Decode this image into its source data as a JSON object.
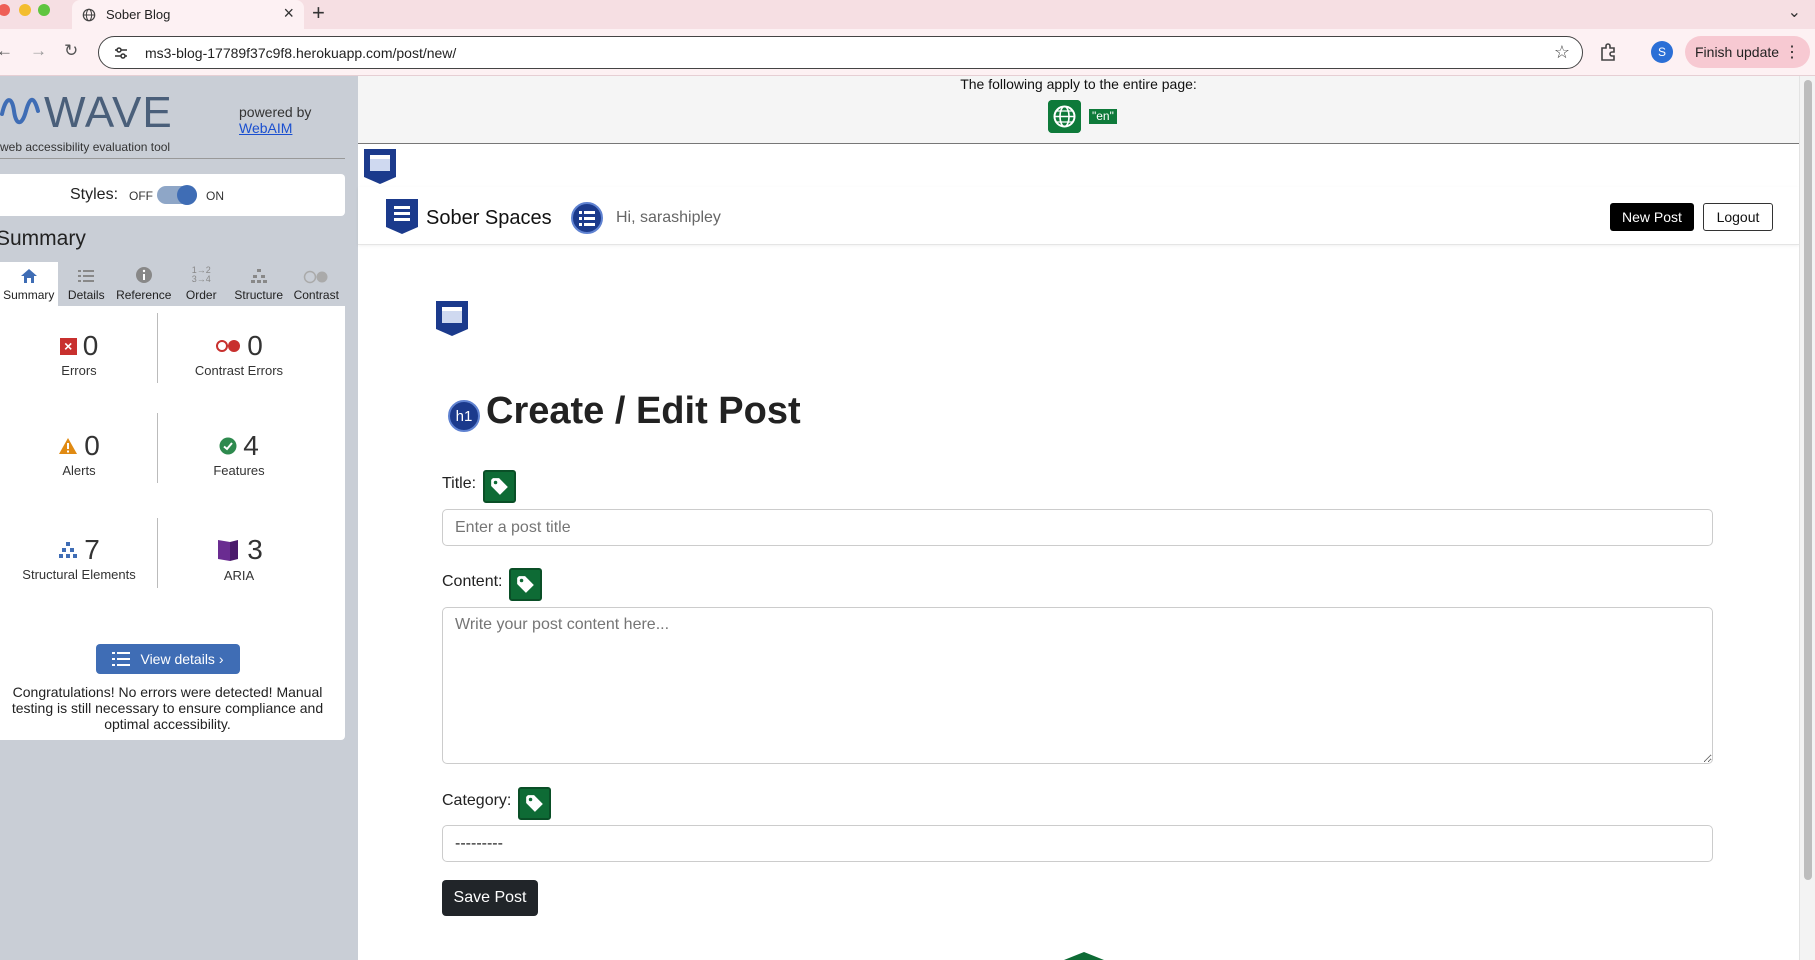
{
  "browser": {
    "tab_title": "Sober Blog",
    "tab_close": "×",
    "new_tab": "+",
    "url": "ms3-blog-17789f37c9f8.herokuapp.com/post/new/",
    "profile_initial": "S",
    "finish_update": "Finish update"
  },
  "wave": {
    "name": "WAVE",
    "subtitle": "web accessibility evaluation tool",
    "powered_by": "powered by",
    "webaim": "WebAIM",
    "styles_label": "Styles:",
    "off": "OFF",
    "on": "ON",
    "summary_heading": "Summary",
    "tabs": [
      {
        "label": "Summary",
        "icon": "home-icon"
      },
      {
        "label": "Details",
        "icon": "list-icon"
      },
      {
        "label": "Reference",
        "icon": "info-icon"
      },
      {
        "label": "Order",
        "icon": "order-icon"
      },
      {
        "label": "Structure",
        "icon": "structure-icon"
      },
      {
        "label": "Contrast",
        "icon": "contrast-icon"
      }
    ],
    "stats": {
      "errors": {
        "count": "0",
        "label": "Errors"
      },
      "contrast_errors": {
        "count": "0",
        "label": "Contrast Errors"
      },
      "alerts": {
        "count": "0",
        "label": "Alerts"
      },
      "features": {
        "count": "4",
        "label": "Features"
      },
      "structural": {
        "count": "7",
        "label": "Structural Elements"
      },
      "aria": {
        "count": "3",
        "label": "ARIA"
      }
    },
    "view_details": "View details ›",
    "congrats": "Congratulations! No errors were detected! Manual testing is still necessary to ensure compliance and optimal accessibility.",
    "colors": {
      "accent": "#3f6db5",
      "feature_green": "#0e7a3a",
      "error_red": "#c8302e"
    }
  },
  "page": {
    "apply_text": "The following apply to the entire page:",
    "lang_tag": "\"en\"",
    "brand": "Sober Spaces",
    "greeting": "Hi, sarashipley",
    "new_post": "New Post",
    "logout": "Logout",
    "h1_badge": "h1",
    "title": "Create / Edit Post",
    "title_label": "Title:",
    "title_placeholder": "Enter a post title",
    "content_label": "Content:",
    "content_placeholder": "Write your post content here...",
    "category_label": "Category:",
    "category_value": "---------",
    "save": "Save Post"
  }
}
